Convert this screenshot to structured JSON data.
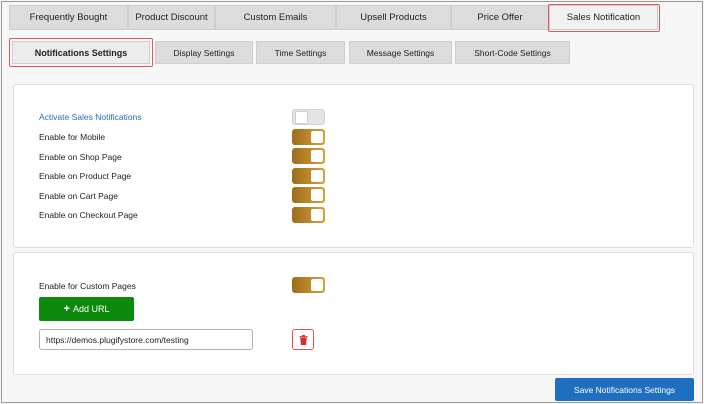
{
  "top_tabs": [
    {
      "label": "Frequently Bought"
    },
    {
      "label": "Product Discount"
    },
    {
      "label": "Custom Emails"
    },
    {
      "label": "Upsell Products"
    },
    {
      "label": "Price Offer"
    },
    {
      "label": "Sales Notification",
      "active": true
    }
  ],
  "sub_tabs": [
    {
      "label": "Notifications Settings",
      "active": true
    },
    {
      "label": "Display Settings"
    },
    {
      "label": "Time Settings"
    },
    {
      "label": "Message Settings"
    },
    {
      "label": "Short-Code Settings"
    }
  ],
  "settings": [
    {
      "label": "Activate Sales Notifications",
      "enabled": false
    },
    {
      "label": "Enable for Mobile",
      "enabled": true
    },
    {
      "label": "Enable on Shop Page",
      "enabled": true
    },
    {
      "label": "Enable on Product Page",
      "enabled": true
    },
    {
      "label": "Enable on Cart Page",
      "enabled": true
    },
    {
      "label": "Enable on Checkout Page",
      "enabled": true
    }
  ],
  "custom_pages": {
    "label": "Enable for Custom Pages",
    "enabled": true,
    "add_url_label": "Add URL",
    "url_value": "https://demos.plugifystore.com/testing"
  },
  "save_label": "Save Notifications Settings",
  "colors": {
    "toggle_on": "#c4902e",
    "add_button": "#0b8a0b",
    "save_button": "#1f6fc0",
    "highlight": "#e0595a",
    "link_label": "#2b6cb0"
  },
  "icons": {
    "delete": "trash-icon",
    "add": "plus-icon"
  }
}
